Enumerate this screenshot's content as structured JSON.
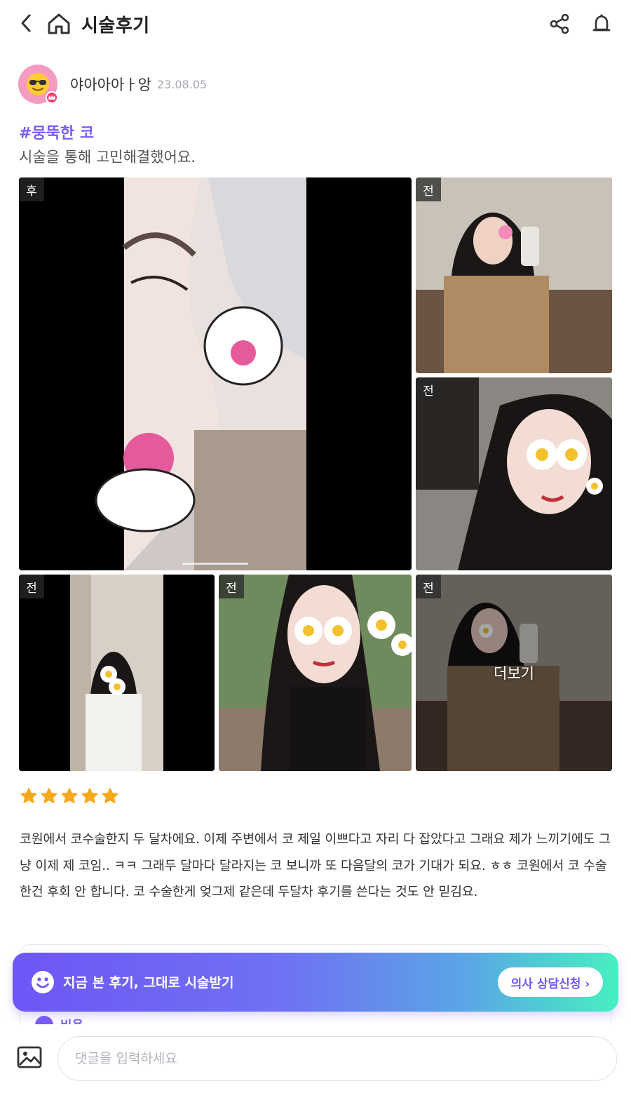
{
  "header": {
    "title": "시술후기"
  },
  "author": {
    "nickname": "야아아아ㅏ앙",
    "date": "23.08.05"
  },
  "post": {
    "tag": "#뭉뚝한 코",
    "subtitle": "시술을 통해 고민해결했어요.",
    "rating": 5,
    "body": "코원에서 코수술한지 두 달차에요. 이제 주변에서 코 제일 이쁘다고 자리 다 잡았다고 그래요 제가 느끼기에도 그냥 이제 제 코임.. ㅋㅋ 그래두 달마다 달라지는 코 보니까 또 다음달의 코가 기대가 되요. ㅎㅎ 코원에서 코 수술 한건 후회 안 합니다. 코 수술한게 엊그제 같은데 두달차 후기를 쓴다는 것도 안 믿김요."
  },
  "photos": [
    {
      "label": "후"
    },
    {
      "label": "전"
    },
    {
      "label": "전"
    },
    {
      "label": "전"
    },
    {
      "label": "전"
    },
    {
      "label": "전",
      "more": "더보기"
    }
  ],
  "banner": {
    "text": "지금 본 후기, 그대로 시술받기",
    "button": "의사 상담신청 ›"
  },
  "cost": {
    "label": "비용"
  },
  "comment": {
    "placeholder": "댓글을 입력하세요"
  },
  "colors": {
    "accent": "#7b5cf6",
    "star": "#f7a81b",
    "gradient_end": "#47f0c0"
  }
}
